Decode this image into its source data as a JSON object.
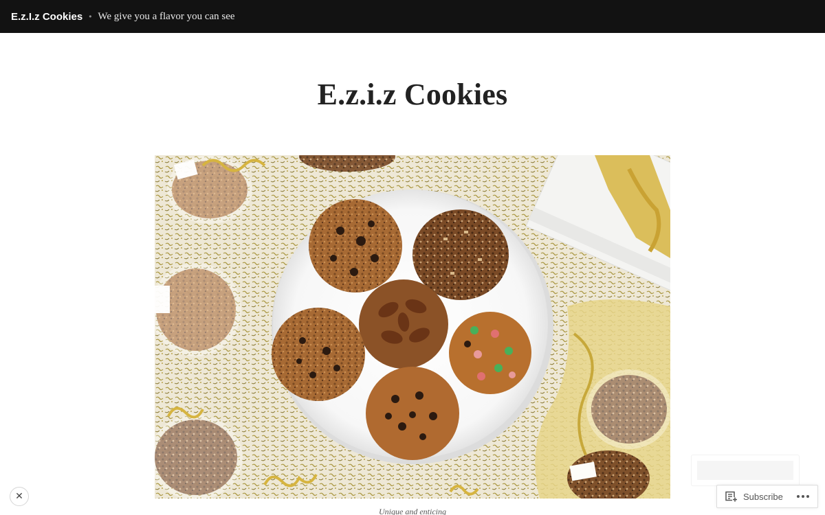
{
  "header": {
    "site_name": "E.z.I.z Cookies",
    "separator": "•",
    "tagline": "We give you a flavor you can see"
  },
  "page": {
    "title": "E.z.i.z Cookies"
  },
  "hero": {
    "caption": "Unique and enticing"
  },
  "actions": {
    "close_glyph": "✕",
    "subscribe_label": "Subscribe",
    "subscribe_icon": "reader-add-icon",
    "more_icon": "ellipsis-icon"
  },
  "colors": {
    "topbar_bg": "#121212",
    "page_bg": "#ffffff",
    "title_text": "#222222"
  }
}
